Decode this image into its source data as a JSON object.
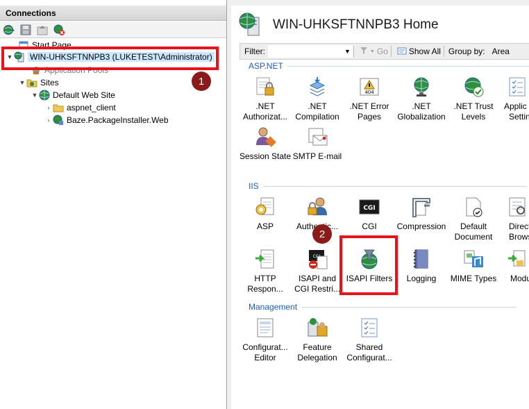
{
  "connections": {
    "header": "Connections",
    "toolbar_icons": [
      "connect-globe-icon",
      "save-icon",
      "up-icon",
      "disconnect-icon"
    ],
    "tree": {
      "start_page": "Start Page",
      "server": "WIN-UHKSFTNNPB3 (LUKETEST\\Administrator)",
      "app_pools": "Application Pools",
      "sites": "Sites",
      "default_site": "Default Web Site",
      "aspnet_client": "aspnet_client",
      "baze": "Baze.PackageInstaller.Web"
    }
  },
  "callouts": {
    "one": "1",
    "two": "2",
    "accent": "#e8141b",
    "badge_color": "#8b1a1a"
  },
  "home": {
    "title": "WIN-UHKSFTNNPB3 Home",
    "filter_label": "Filter:",
    "go": "Go",
    "show_all": "Show All",
    "group_by_label": "Group by:",
    "group_by_value": "Area"
  },
  "sections": {
    "aspnet": {
      "heading": "ASP.NET",
      "features": [
        {
          "l1": ".NET",
          "l2": "Authorizat..."
        },
        {
          "l1": ".NET",
          "l2": "Compilation"
        },
        {
          "l1": ".NET Error",
          "l2": "Pages"
        },
        {
          "l1": ".NET",
          "l2": "Globalization"
        },
        {
          "l1": ".NET Trust",
          "l2": "Levels"
        },
        {
          "l1": "Applic",
          "l2": "Settin"
        },
        {
          "l1": "Session State",
          "l2": ""
        },
        {
          "l1": "SMTP E-mail",
          "l2": ""
        }
      ]
    },
    "iis": {
      "heading": "IIS",
      "features": [
        {
          "l1": "ASP",
          "l2": ""
        },
        {
          "l1": "Authentic...",
          "l2": ""
        },
        {
          "l1": "CGI",
          "l2": ""
        },
        {
          "l1": "Compression",
          "l2": ""
        },
        {
          "l1": "Default",
          "l2": "Document"
        },
        {
          "l1": "Direct",
          "l2": "Brows"
        },
        {
          "l1": "HTTP",
          "l2": "Respon..."
        },
        {
          "l1": "ISAPI and",
          "l2": "CGI Restri..."
        },
        {
          "l1": "ISAPI Filters",
          "l2": ""
        },
        {
          "l1": "Logging",
          "l2": ""
        },
        {
          "l1": "MIME Types",
          "l2": ""
        },
        {
          "l1": "Modu",
          "l2": ""
        }
      ]
    },
    "management": {
      "heading": "Management",
      "features": [
        {
          "l1": "Configurat...",
          "l2": "Editor"
        },
        {
          "l1": "Feature",
          "l2": "Delegation"
        },
        {
          "l1": "Shared",
          "l2": "Configurat..."
        }
      ]
    }
  }
}
